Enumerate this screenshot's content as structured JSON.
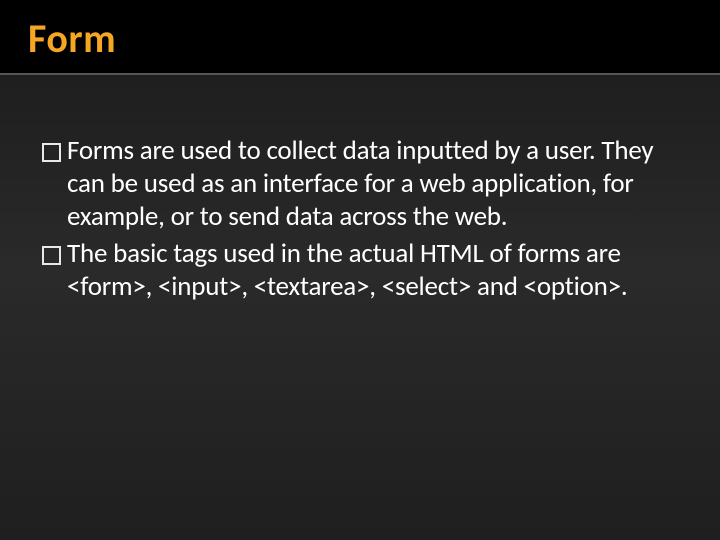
{
  "title": "Form",
  "bullets": [
    "Forms are used to collect data inputted by a user. They can be used as an interface for a web application, for example, or to send data across the web.",
    "The basic tags used in the actual HTML of forms are <form>, <input>, <textarea>, <select> and <option>."
  ]
}
